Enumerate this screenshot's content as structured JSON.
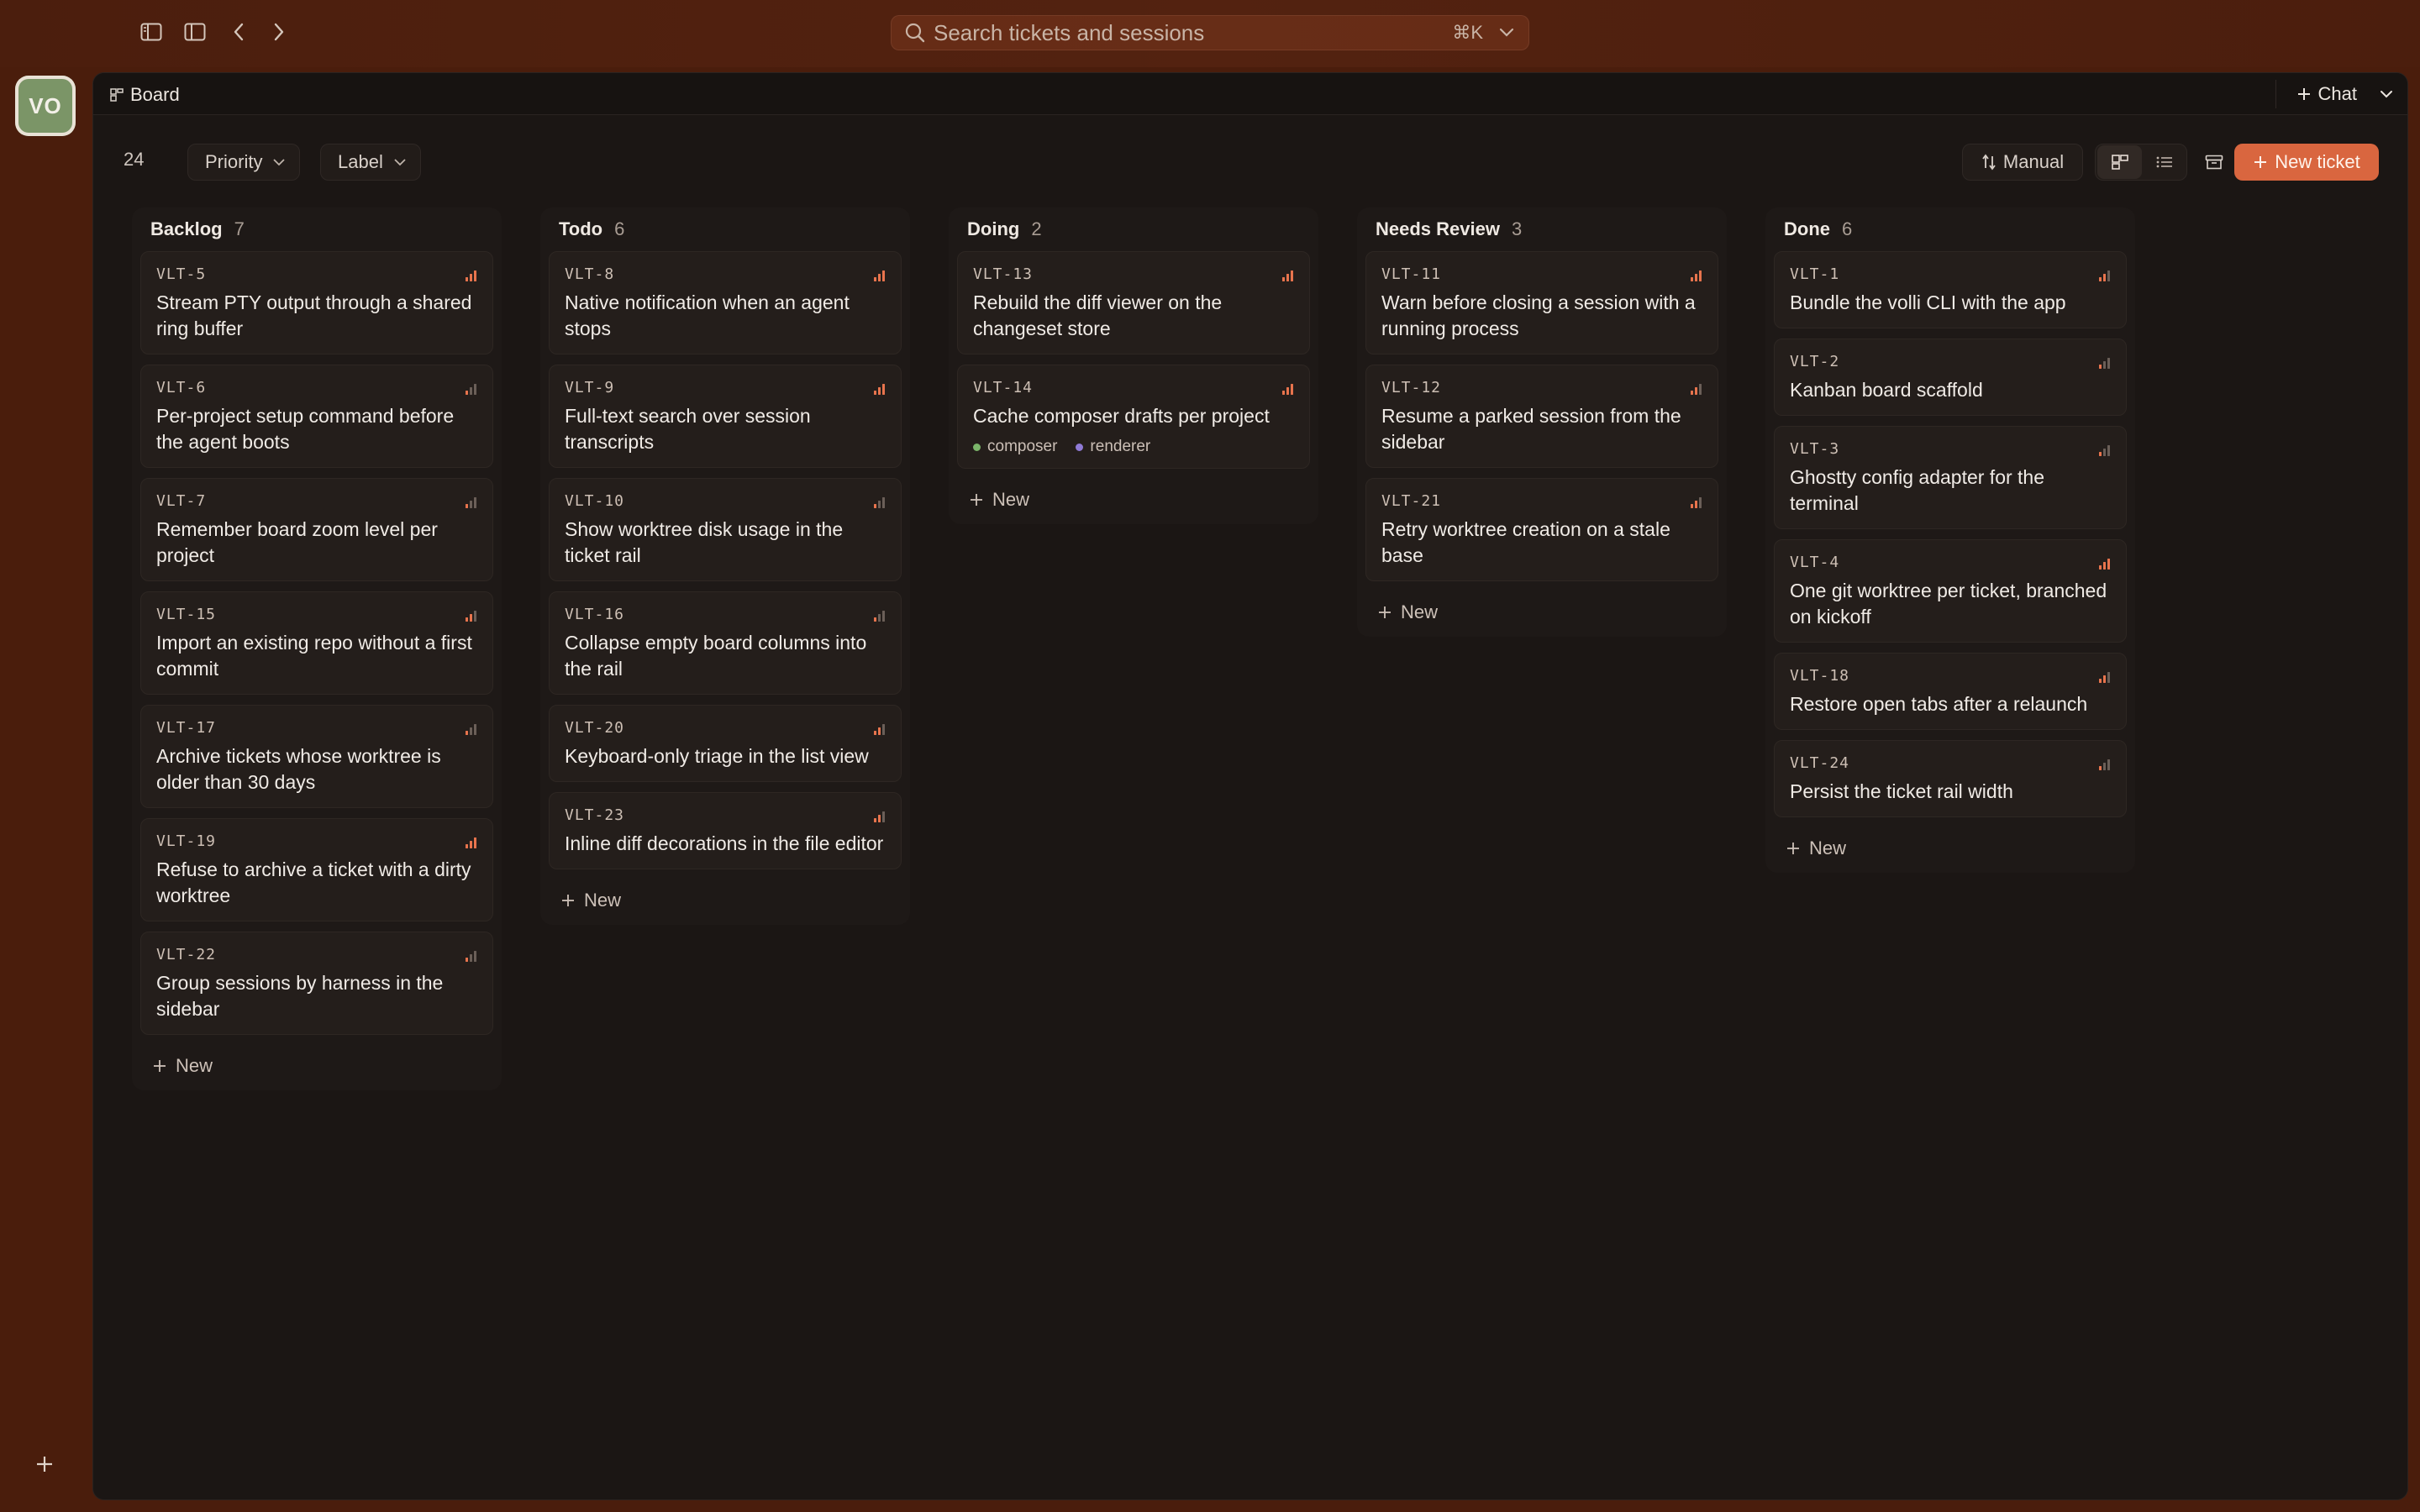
{
  "search": {
    "placeholder": "Search tickets and sessions",
    "shortcut": "⌘K"
  },
  "rail": {
    "avatar_initials": "VO"
  },
  "tabs": {
    "board_label": "Board",
    "chat_label": "Chat"
  },
  "toolbar": {
    "ticket_count": "24",
    "filters": [
      "Priority",
      "Label"
    ],
    "sort_label": "Manual",
    "new_ticket_label": "New ticket"
  },
  "new_label": "New",
  "colors": {
    "accent": "#d9663f",
    "background": "#4a1d0c",
    "panel": "#1b1614",
    "priority_active": "#e8744d",
    "priority_inactive": "#6b5f58"
  },
  "columns": [
    {
      "title": "Backlog",
      "count": "7",
      "cards": [
        {
          "id": "VLT-5",
          "title": "Stream PTY output through a shared ring buffer",
          "priority": 3
        },
        {
          "id": "VLT-6",
          "title": "Per-project setup command before the agent boots",
          "priority": 1
        },
        {
          "id": "VLT-7",
          "title": "Remember board zoom level per project",
          "priority": 1
        },
        {
          "id": "VLT-15",
          "title": "Import an existing repo without a first commit",
          "priority": 2
        },
        {
          "id": "VLT-17",
          "title": "Archive tickets whose worktree is older than 30 days",
          "priority": 1
        },
        {
          "id": "VLT-19",
          "title": "Refuse to archive a ticket with a dirty worktree",
          "priority": 3
        },
        {
          "id": "VLT-22",
          "title": "Group sessions by harness in the sidebar",
          "priority": 1
        }
      ]
    },
    {
      "title": "Todo",
      "count": "6",
      "cards": [
        {
          "id": "VLT-8",
          "title": "Native notification when an agent stops",
          "priority": 4
        },
        {
          "id": "VLT-9",
          "title": "Full-text search over session transcripts",
          "priority": 3
        },
        {
          "id": "VLT-10",
          "title": "Show worktree disk usage in the ticket rail",
          "priority": 1
        },
        {
          "id": "VLT-16",
          "title": "Collapse empty board columns into the rail",
          "priority": 1
        },
        {
          "id": "VLT-20",
          "title": "Keyboard-only triage in the list view",
          "priority": 2
        },
        {
          "id": "VLT-23",
          "title": "Inline diff decorations in the file editor",
          "priority": 2
        }
      ]
    },
    {
      "title": "Doing",
      "count": "2",
      "cards": [
        {
          "id": "VLT-13",
          "title": "Rebuild the diff viewer on the changeset store",
          "priority": 4
        },
        {
          "id": "VLT-14",
          "title": "Cache composer drafts per project",
          "priority": 4,
          "labels": [
            {
              "name": "composer",
              "color": "#7bb56a"
            },
            {
              "name": "renderer",
              "color": "#8f7ad6"
            }
          ]
        }
      ]
    },
    {
      "title": "Needs Review",
      "count": "3",
      "cards": [
        {
          "id": "VLT-11",
          "title": "Warn before closing a session with a running process",
          "priority": 4
        },
        {
          "id": "VLT-12",
          "title": "Resume a parked session from the sidebar",
          "priority": 2
        },
        {
          "id": "VLT-21",
          "title": "Retry worktree creation on a stale base",
          "priority": 2
        }
      ]
    },
    {
      "title": "Done",
      "count": "6",
      "cards": [
        {
          "id": "VLT-1",
          "title": "Bundle the volli CLI with the app",
          "priority": 2
        },
        {
          "id": "VLT-2",
          "title": "Kanban board scaffold",
          "priority": 1
        },
        {
          "id": "VLT-3",
          "title": "Ghostty config adapter for the terminal",
          "priority": 1
        },
        {
          "id": "VLT-4",
          "title": "One git worktree per ticket, branched on kickoff",
          "priority": 4
        },
        {
          "id": "VLT-18",
          "title": "Restore open tabs after a relaunch",
          "priority": 2
        },
        {
          "id": "VLT-24",
          "title": "Persist the ticket rail width",
          "priority": 1
        }
      ]
    }
  ]
}
